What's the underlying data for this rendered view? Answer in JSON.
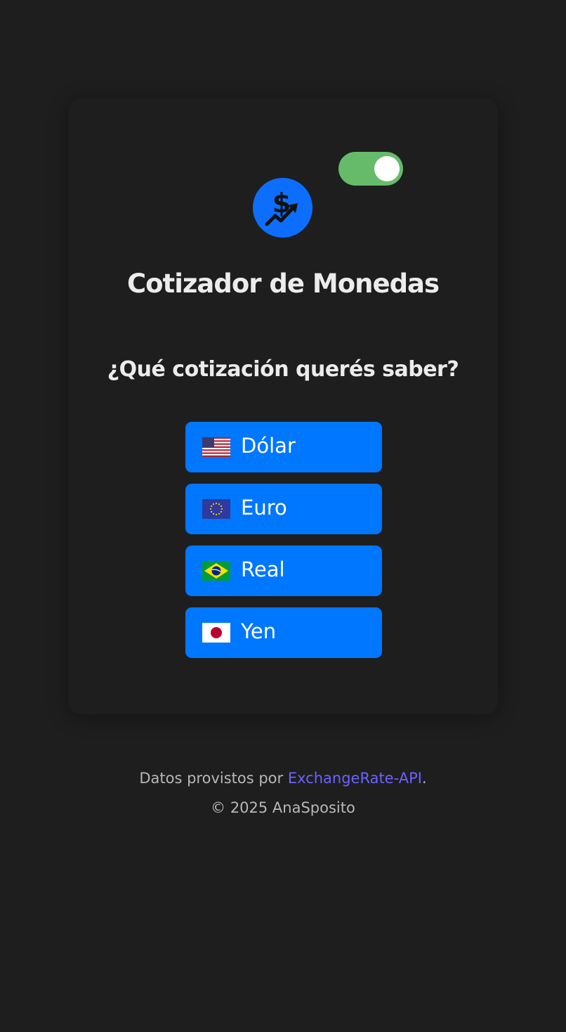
{
  "theme_toggle": {
    "state": "on",
    "color": "#66bb6a"
  },
  "logo": {
    "icon": "dollar-chart-icon",
    "color": "#0d6efd"
  },
  "title": "Cotizador de Monedas",
  "question": "¿Qué cotización querés saber?",
  "currencies": [
    {
      "label": "Dólar",
      "flag": "us-flag-icon"
    },
    {
      "label": "Euro",
      "flag": "eu-flag-icon"
    },
    {
      "label": "Real",
      "flag": "brazil-flag-icon"
    },
    {
      "label": "Yen",
      "flag": "japan-flag-icon"
    }
  ],
  "button_color": "#0077ff",
  "footer": {
    "prefix": "Datos provistos por ",
    "link_text": "ExchangeRate-API",
    "suffix": ".",
    "copyright": "© 2025 AnaSposito"
  }
}
